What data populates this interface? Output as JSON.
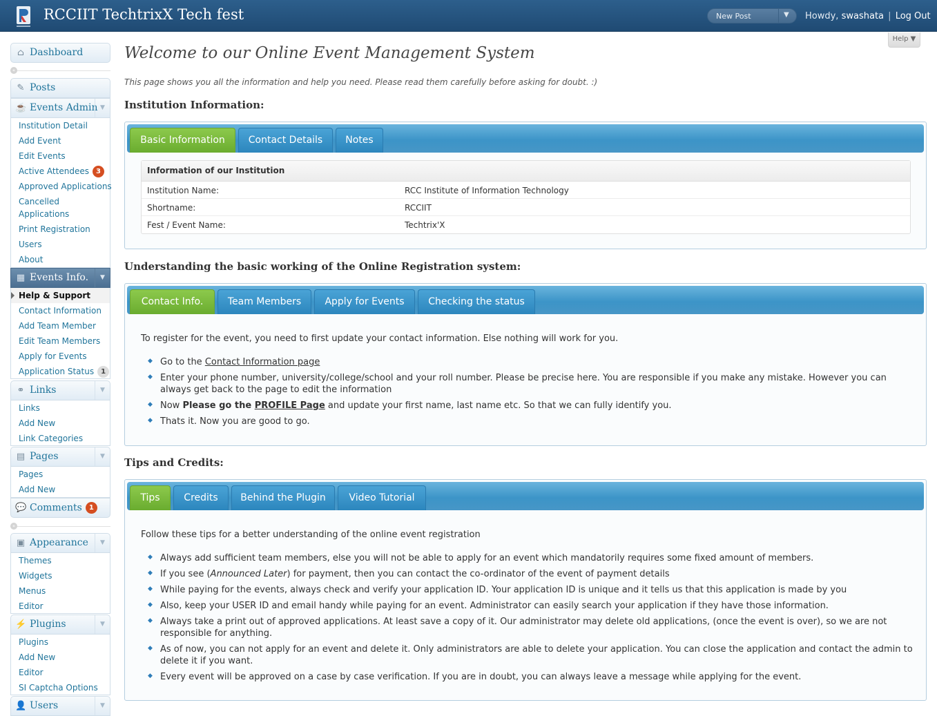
{
  "header": {
    "site_title": "RCCIIT TechtrixX Tech fest",
    "new_post_label": "New Post",
    "howdy_prefix": "Howdy,",
    "username": "swashata",
    "separator": "|",
    "logout_label": "Log Out",
    "help_label": "Help"
  },
  "sidebar": {
    "dashboard": "Dashboard",
    "posts": "Posts",
    "events_admin": {
      "label": "Events Admin",
      "items": [
        "Institution Detail",
        "Add Event",
        "Edit Events",
        "Active Attendees",
        "Approved Applications",
        "Cancelled Applications",
        "Print Registration",
        "Users",
        "About"
      ],
      "active_attendees_badge": "3"
    },
    "events_info": {
      "label": "Events Info.",
      "items": [
        "Help & Support",
        "Contact Information",
        "Add Team Member",
        "Edit Team Members",
        "Apply for Events",
        "Application Status"
      ],
      "application_status_badge": "1"
    },
    "links": {
      "label": "Links",
      "items": [
        "Links",
        "Add New",
        "Link Categories"
      ]
    },
    "pages": {
      "label": "Pages",
      "items": [
        "Pages",
        "Add New"
      ]
    },
    "comments": {
      "label": "Comments",
      "badge": "1"
    },
    "appearance": {
      "label": "Appearance",
      "items": [
        "Themes",
        "Widgets",
        "Menus",
        "Editor"
      ]
    },
    "plugins": {
      "label": "Plugins",
      "items": [
        "Plugins",
        "Add New",
        "Editor",
        "SI Captcha Options"
      ]
    },
    "users": {
      "label": "Users"
    }
  },
  "main": {
    "title": "Welcome to our Online Event Management System",
    "intro": "This page shows you all the information and help you need. Please read them carefully before asking for doubt. :)",
    "institution": {
      "heading": "Institution Information:",
      "tabs": [
        "Basic Information",
        "Contact Details",
        "Notes"
      ],
      "table_title": "Information of our Institution",
      "rows": [
        {
          "label": "Institution Name:",
          "value": "RCC Institute of Information Technology"
        },
        {
          "label": "Shortname:",
          "value": "RCCIIT"
        },
        {
          "label": "Fest / Event Name:",
          "value": "Techtrix'X"
        }
      ]
    },
    "registration": {
      "heading": "Understanding the basic working of the Online Registration system:",
      "tabs": [
        "Contact Info.",
        "Team Members",
        "Apply for Events",
        "Checking the status"
      ],
      "intro": "To register for the event, you need to first update your contact information. Else nothing will work for you.",
      "b1_prefix": "Go to the ",
      "b1_link": "Contact Information page",
      "b2": "Enter your phone number, university/college/school and your roll number. Please be precise here. You are responsible if you make any mistake. However you can always get back to the page to edit the information",
      "b3_prefix": "Now ",
      "b3_bold": "Please go the ",
      "b3_link": "PROFILE Page",
      "b3_suffix": " and update your first name, last name etc. So that we can fully identify you.",
      "b4": "Thats it. Now you are good to go."
    },
    "tips": {
      "heading": "Tips and Credits:",
      "tabs": [
        "Tips",
        "Credits",
        "Behind the Plugin",
        "Video Tutorial"
      ],
      "intro": "Follow these tips for a better understanding of the online event registration",
      "t1": "Always add sufficient team members, else you will not be able to apply for an event which mandatorily requires some fixed amount of members.",
      "t2_prefix": "If you see (",
      "t2_em": "Announced Later",
      "t2_suffix": ") for payment, then you can contact the co-ordinator of the event of payment details",
      "t3": "While paying for the events, always check and verify your application ID. Your application ID is unique and it tells us that this application is made by you",
      "t4": "Also, keep your USER ID and email handy while paying for an event. Administrator can easily search your application if they have those information.",
      "t5": "Always take a print out of approved applications. At least save a copy of it. Our administrator may delete old applications, (once the event is over), so we are not responsible for anything.",
      "t6": "As of now, you can not apply for an event and delete it. Only administrators are able to delete your application. You can close the application and contact the admin to delete it if you want.",
      "t7": "Every event will be approved on a case by case verification. If you are in doubt, you can always leave a message while applying for the event."
    }
  },
  "colors": {
    "header_bg": "#245482",
    "link": "#21759b",
    "tab_active": "#7bbb3e",
    "tab_inactive": "#3a93c9",
    "badge": "#d54e21"
  }
}
